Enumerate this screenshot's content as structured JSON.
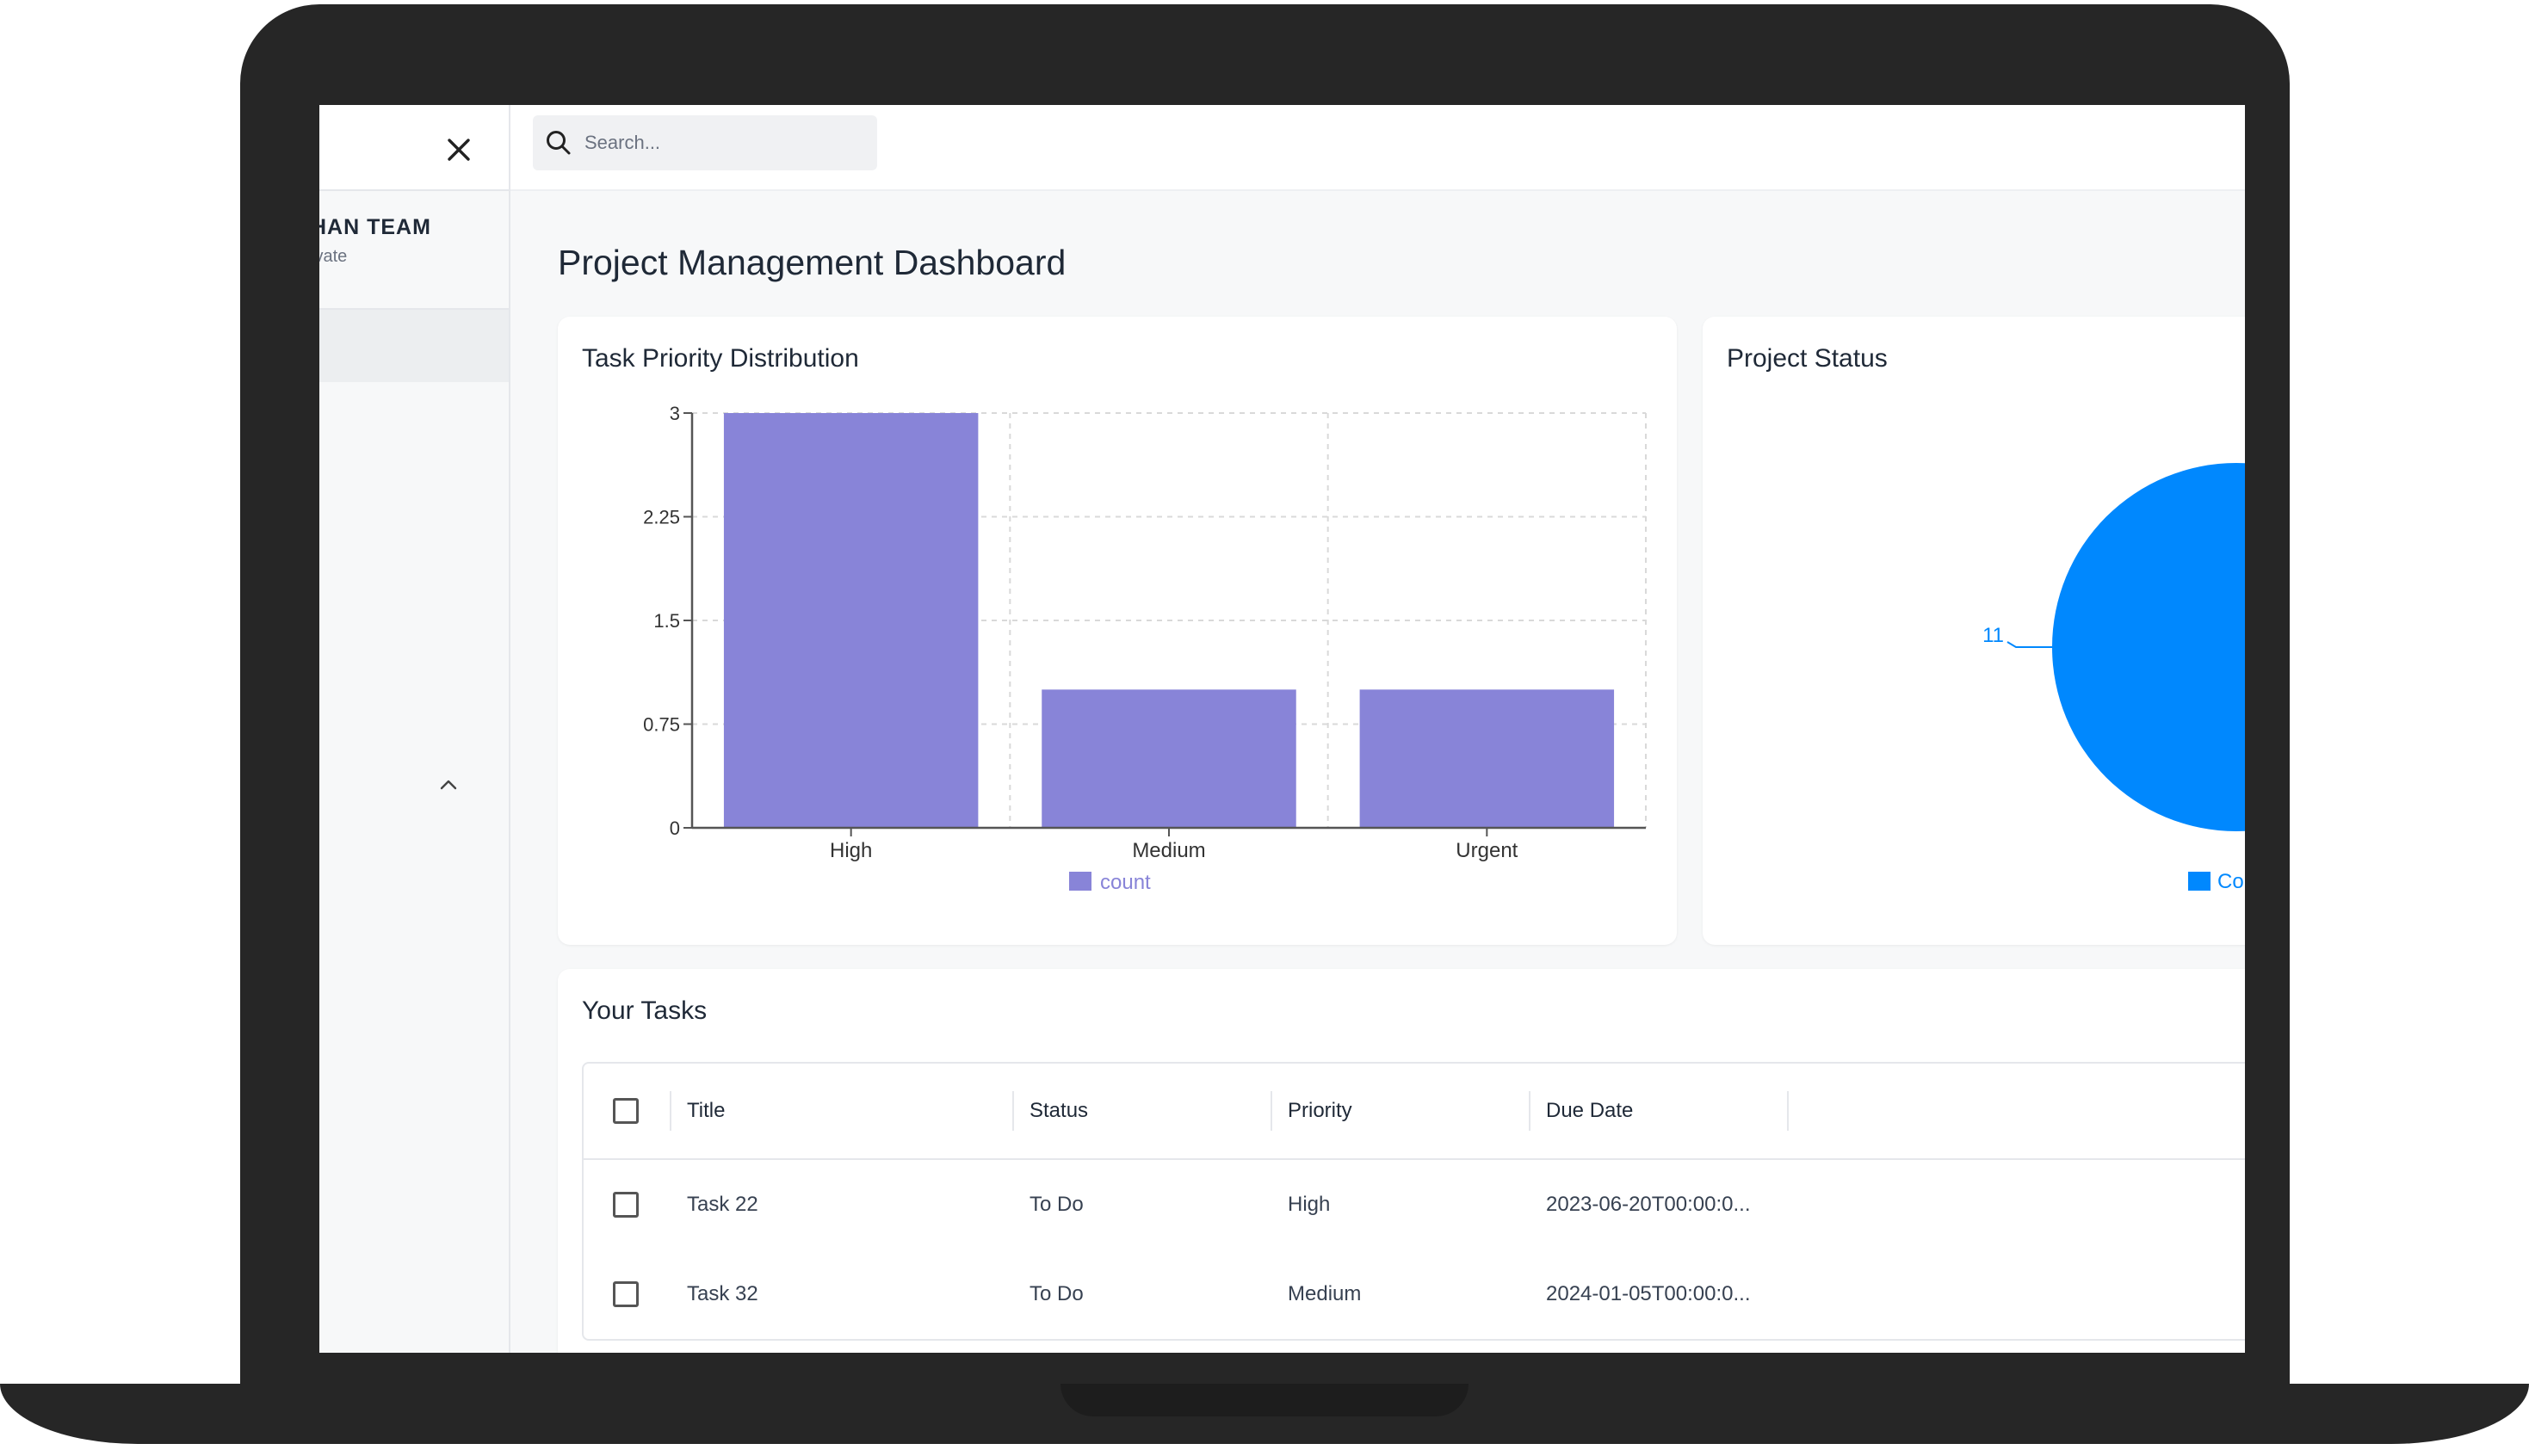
{
  "sidebar": {
    "team_name": "HAN TEAM",
    "team_sub": "ivate"
  },
  "search": {
    "placeholder": "Search..."
  },
  "page_title": "Project Management Dashboard",
  "priority_card": {
    "title": "Task Priority Distribution"
  },
  "status_card": {
    "title": "Project Status",
    "pie_label": "11",
    "legend_label": "Co"
  },
  "tasks_card": {
    "title": "Your Tasks",
    "columns": [
      "Title",
      "Status",
      "Priority",
      "Due Date"
    ],
    "rows": [
      {
        "title": "Task 22",
        "status": "To Do",
        "priority": "High",
        "due": "2023-06-20T00:00:0..."
      },
      {
        "title": "Task 32",
        "status": "To Do",
        "priority": "Medium",
        "due": "2024-01-05T00:00:0..."
      }
    ]
  },
  "colors": {
    "bar": "#8884d8",
    "pie": "#0088fe"
  },
  "chart_data": [
    {
      "type": "bar",
      "title": "Task Priority Distribution",
      "categories": [
        "High",
        "Medium",
        "Urgent"
      ],
      "series": [
        {
          "name": "count",
          "values": [
            3,
            1,
            1
          ]
        }
      ],
      "yticks": [
        "0",
        "0.75",
        "1.5",
        "2.25",
        "3"
      ],
      "ylim": [
        0,
        3
      ],
      "grid": true,
      "legend": "bottom"
    },
    {
      "type": "pie",
      "title": "Project Status",
      "labels": [
        "11"
      ],
      "values": [
        11
      ],
      "legend": "bottom"
    }
  ]
}
